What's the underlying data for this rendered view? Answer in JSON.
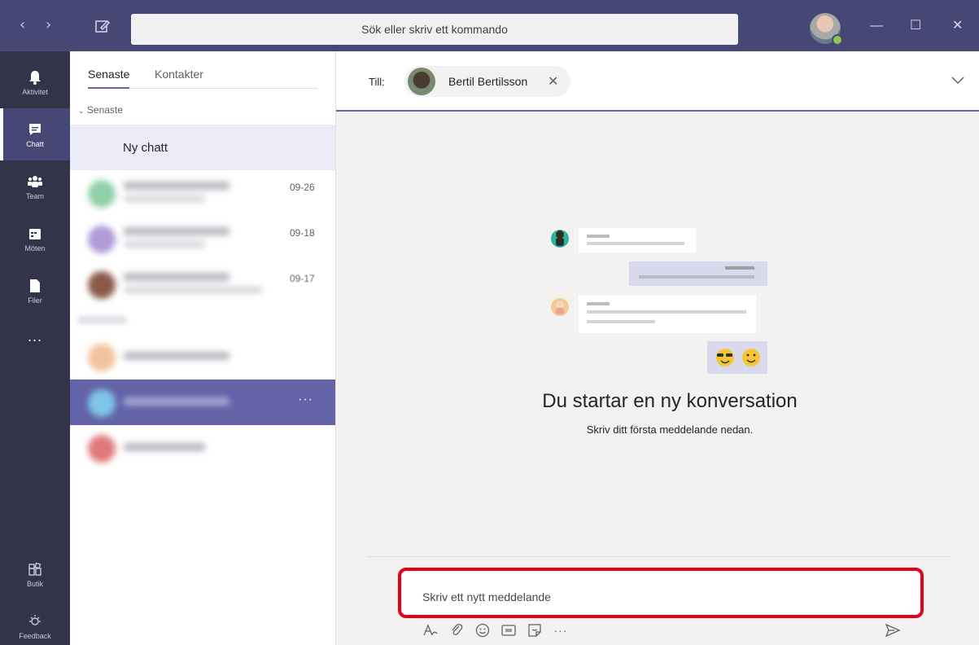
{
  "titlebar": {
    "back": "‹",
    "forward": "›",
    "search_placeholder": "Sök eller skriv ett kommando",
    "minimize": "—",
    "maximize": "☐",
    "close": "✕"
  },
  "rail": {
    "items": [
      {
        "label": "Aktivitet",
        "icon": "bell-icon"
      },
      {
        "label": "Chatt",
        "icon": "chat-icon",
        "active": true
      },
      {
        "label": "Team",
        "icon": "teams-icon"
      },
      {
        "label": "Möten",
        "icon": "calendar-icon"
      },
      {
        "label": "Filer",
        "icon": "file-icon"
      },
      {
        "label": "...",
        "icon": "more-icon"
      }
    ],
    "bottom": [
      {
        "label": "Butik",
        "icon": "store-icon"
      },
      {
        "label": "Feedback",
        "icon": "feedback-icon"
      }
    ]
  },
  "chatlist": {
    "tabs": [
      "Senaste",
      "Kontakter"
    ],
    "section": "Senaste",
    "new_chat": "Ny chatt",
    "rows": [
      {
        "time": "09-26"
      },
      {
        "time": "09-18"
      },
      {
        "time": "09-17"
      }
    ],
    "more": "···"
  },
  "main": {
    "to_label": "Till:",
    "recipient": "Bertil Bertilsson",
    "remove": "✕",
    "headline": "Du startar en ny konversation",
    "subline": "Skriv ditt första meddelande nedan.",
    "compose_placeholder": "Skriv ett nytt meddelande",
    "more": "···"
  },
  "colors": {
    "brand": "#464775",
    "accent": "#6264a7",
    "highlight": "#e3001b"
  }
}
